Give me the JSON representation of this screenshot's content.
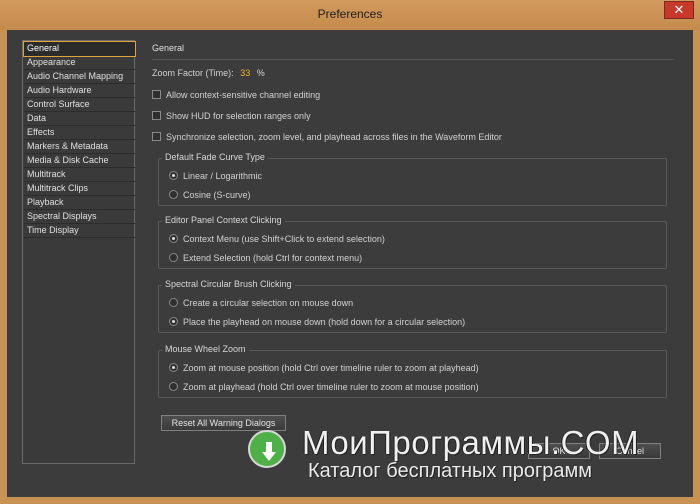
{
  "window": {
    "title": "Preferences",
    "close_glyph": "✕"
  },
  "sidebar": {
    "items": [
      {
        "label": "General",
        "selected": true
      },
      {
        "label": "Appearance"
      },
      {
        "label": "Audio Channel Mapping"
      },
      {
        "label": "Audio Hardware"
      },
      {
        "label": "Control Surface"
      },
      {
        "label": "Data"
      },
      {
        "label": "Effects"
      },
      {
        "label": "Markers & Metadata"
      },
      {
        "label": "Media & Disk Cache"
      },
      {
        "label": "Multitrack"
      },
      {
        "label": "Multitrack Clips"
      },
      {
        "label": "Playback"
      },
      {
        "label": "Spectral Displays"
      },
      {
        "label": "Time Display"
      }
    ]
  },
  "general": {
    "heading": "General",
    "zoom_label": "Zoom Factor (Time):",
    "zoom_value": "33",
    "zoom_unit": "%",
    "checkboxes": [
      {
        "label": "Allow context-sensitive channel editing",
        "checked": false
      },
      {
        "label": "Show HUD for selection ranges only",
        "checked": false
      },
      {
        "label": "Synchronize selection, zoom level, and playhead across files in the Waveform Editor",
        "checked": false
      }
    ],
    "groups": [
      {
        "title": "Default Fade Curve Type",
        "options": [
          {
            "label": "Linear / Logarithmic",
            "checked": true
          },
          {
            "label": "Cosine (S-curve)",
            "checked": false
          }
        ]
      },
      {
        "title": "Editor Panel Context Clicking",
        "options": [
          {
            "label": "Context Menu (use Shift+Click to extend selection)",
            "checked": true
          },
          {
            "label": "Extend Selection (hold Ctrl for context menu)",
            "checked": false
          }
        ]
      },
      {
        "title": "Spectral Circular Brush Clicking",
        "options": [
          {
            "label": "Create a circular selection on mouse down",
            "checked": false
          },
          {
            "label": "Place the playhead on mouse down (hold down for a circular selection)",
            "checked": true
          }
        ]
      },
      {
        "title": "Mouse Wheel Zoom",
        "options": [
          {
            "label": "Zoom at mouse position (hold Ctrl over timeline ruler to zoom at playhead)",
            "checked": true
          },
          {
            "label": "Zoom at playhead (hold Ctrl over timeline ruler to zoom at mouse position)",
            "checked": false
          }
        ]
      }
    ],
    "reset_button": "Reset All Warning Dialogs"
  },
  "footer": {
    "ok_label": "OK",
    "cancel_label": "Cancel"
  },
  "watermark": {
    "title": "МоиПрограммы.COM",
    "subtitle": "Каталог бесплатных программ"
  },
  "colors": {
    "accent": "#f0b429",
    "frame": "#c89254",
    "background": "#3c3c3c"
  }
}
